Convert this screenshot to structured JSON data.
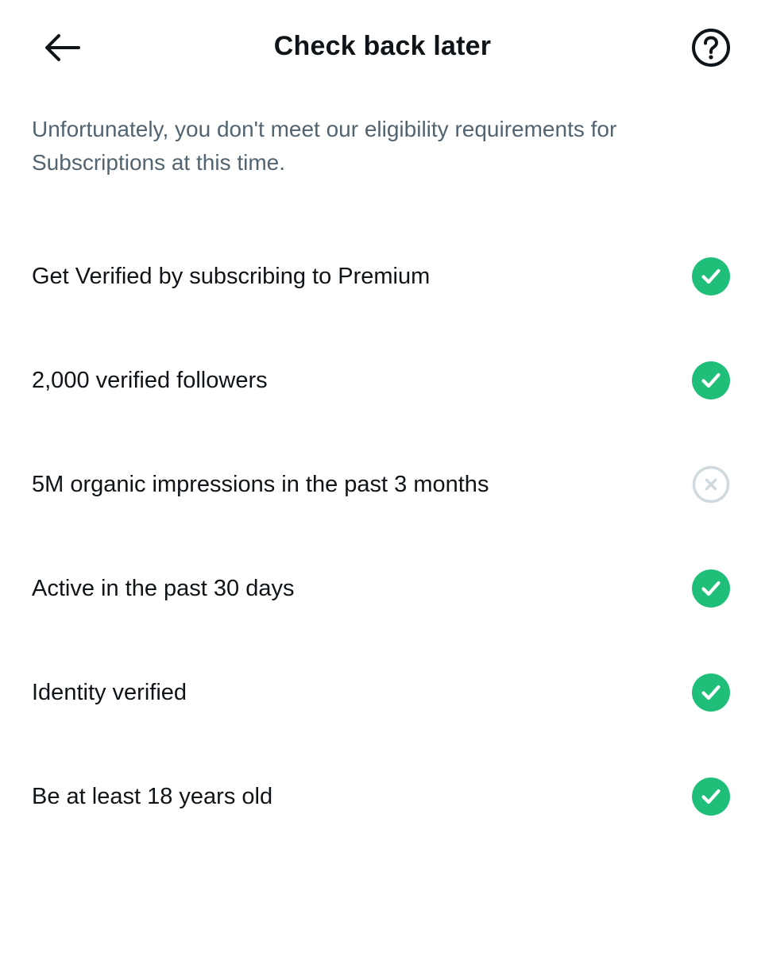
{
  "header": {
    "title": "Check back later",
    "back_icon": "arrow-left-icon",
    "help_icon": "question-circle-icon"
  },
  "description": "Unfortunately, you don't meet our eligibility requirements for Subscriptions at this time.",
  "colors": {
    "met": "#1fbf7a",
    "unmet": "#cfd9de",
    "text_primary": "#0f1419",
    "text_secondary": "#536471"
  },
  "requirements": [
    {
      "label": "Get Verified by subscribing to Premium",
      "met": true,
      "icon": "check-circle-icon"
    },
    {
      "label": "2,000 verified followers",
      "met": true,
      "icon": "check-circle-icon"
    },
    {
      "label": "5M organic impressions in the past 3 months",
      "met": false,
      "icon": "x-circle-icon"
    },
    {
      "label": "Active in the past 30 days",
      "met": true,
      "icon": "check-circle-icon"
    },
    {
      "label": "Identity verified",
      "met": true,
      "icon": "check-circle-icon"
    },
    {
      "label": "Be at least 18 years old",
      "met": true,
      "icon": "check-circle-icon"
    }
  ]
}
